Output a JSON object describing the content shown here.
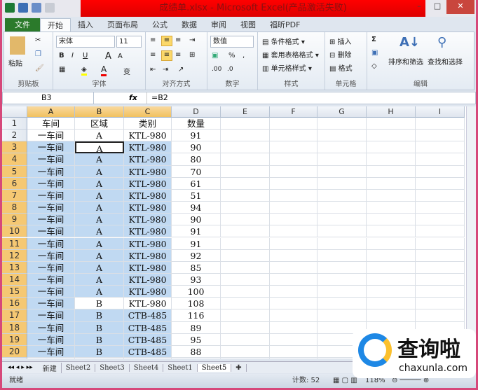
{
  "window": {
    "title": "成绩单.xlsx - Microsoft Excel(产品激活失败)"
  },
  "tabs": [
    "文件",
    "开始",
    "插入",
    "页面布局",
    "公式",
    "数据",
    "审阅",
    "视图",
    "福昕PDF"
  ],
  "ribbon": {
    "clipboard": {
      "paste": "粘贴",
      "label": "剪贴板"
    },
    "font": {
      "name": "宋体",
      "size": "11",
      "bold": "B",
      "italic": "I",
      "underline": "U",
      "grow": "A",
      "shrink": "A",
      "color": "A",
      "phonetic": "变",
      "label": "字体"
    },
    "alignment": {
      "label": "对齐方式"
    },
    "number": {
      "format": "数值",
      "percent": "%",
      "comma": ",",
      "label": "数字"
    },
    "styles": {
      "conditional": "条件格式",
      "table": "套用表格格式",
      "cell": "单元格样式",
      "label": "样式"
    },
    "cells": {
      "insert": "插入",
      "delete": "删除",
      "format": "格式",
      "label": "单元格"
    },
    "editing": {
      "sum": "Σ",
      "sort": "排序和筛选",
      "find": "查找和选择",
      "label": "编辑"
    }
  },
  "formula_bar": {
    "name_box": "B3",
    "fx": "fx",
    "value": "=B2"
  },
  "columns": [
    "A",
    "B",
    "C",
    "D",
    "E",
    "F",
    "G",
    "H",
    "I"
  ],
  "rows": [
    [
      "车间",
      "区域",
      "类别",
      "数量"
    ],
    [
      "一车间",
      "A",
      "KTL-980",
      "91"
    ],
    [
      "一车间",
      "A",
      "KTL-980",
      "90"
    ],
    [
      "一车间",
      "A",
      "KTL-980",
      "80"
    ],
    [
      "一车间",
      "A",
      "KTL-980",
      "70"
    ],
    [
      "一车间",
      "A",
      "KTL-980",
      "61"
    ],
    [
      "一车间",
      "A",
      "KTL-980",
      "51"
    ],
    [
      "一车间",
      "A",
      "KTL-980",
      "94"
    ],
    [
      "一车间",
      "A",
      "KTL-980",
      "90"
    ],
    [
      "一车间",
      "A",
      "KTL-980",
      "91"
    ],
    [
      "一车间",
      "A",
      "KTL-980",
      "91"
    ],
    [
      "一车间",
      "A",
      "KTL-980",
      "92"
    ],
    [
      "一车间",
      "A",
      "KTL-980",
      "85"
    ],
    [
      "一车间",
      "A",
      "KTL-980",
      "93"
    ],
    [
      "一车间",
      "A",
      "KTL-980",
      "100"
    ],
    [
      "一车间",
      "B",
      "KTL-980",
      "108"
    ],
    [
      "一车间",
      "B",
      "CTB-485",
      "116"
    ],
    [
      "一车间",
      "B",
      "CTB-485",
      "89"
    ],
    [
      "一车间",
      "B",
      "CTB-485",
      "95"
    ],
    [
      "一车间",
      "B",
      "CTB-485",
      "88"
    ],
    [
      "",
      "",
      "",
      ""
    ]
  ],
  "sheet_tabs": [
    "新建",
    "Sheet2",
    "Sheet3",
    "Sheet4",
    "Sheet1",
    "Sheet5"
  ],
  "active_sheet": "Sheet5",
  "status": {
    "ready": "就绪",
    "count": "计数: 52",
    "zoom": "118%"
  },
  "watermark": {
    "text": "查询啦",
    "url": "chaxunla.com"
  },
  "colors": {
    "title_red": "#e00000",
    "selection": "#c0d9f2",
    "file_tab": "#2b7a2b"
  }
}
